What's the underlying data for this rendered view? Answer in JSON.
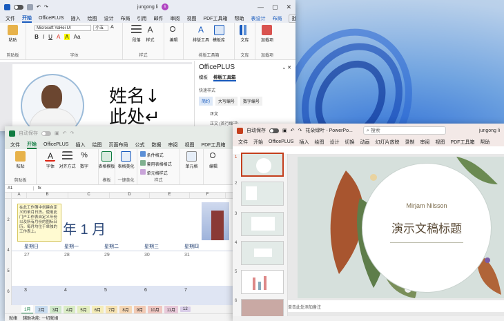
{
  "word": {
    "title": "",
    "user": "jungong li",
    "avatar_initial": "li",
    "tabs": [
      "文件",
      "开始",
      "OfficePLUS",
      "插入",
      "绘图",
      "设计",
      "布局",
      "引用",
      "邮件",
      "审阅",
      "视图",
      "PDF工具箱",
      "帮助",
      "表设计",
      "布局"
    ],
    "comment_label": "批注",
    "font_name": "Microsoft YaHei UI",
    "font_size": "小五",
    "groups": {
      "clipboard": "剪贴板",
      "font": "字体",
      "styles": "样式",
      "typeset": "排版工具箱",
      "docs": "文库",
      "addins": "加载项"
    },
    "buttons": {
      "paste": "粘贴",
      "paragraph": "段落",
      "style": "样式",
      "edit": "编辑",
      "typeset_tool": "排版工具",
      "template_lib": "模板库",
      "library": "文库",
      "addins": "加载项"
    },
    "doc_text_1": "姓名↓",
    "doc_text_2": "此处↵",
    "pane": {
      "title": "OfficePLUS",
      "tabs": [
        "模板",
        "排版工具箱"
      ],
      "section": "快速样式",
      "chips": [
        "简约",
        "大写编号",
        "数字编号"
      ],
      "item1": "正文",
      "item2": "正文 (首行缩进)"
    }
  },
  "excel": {
    "title_left": "自动保存",
    "title_mid": "",
    "tabs": [
      "文件",
      "开始",
      "OfficePLUS",
      "插入",
      "绘图",
      "页面布局",
      "公式",
      "数据",
      "审阅",
      "视图",
      "PDF工具箱",
      "帮助"
    ],
    "groups": {
      "clipboard": "剪贴板",
      "template": "模板",
      "beautify": "一键美化",
      "styles": "样式"
    },
    "buttons": {
      "paste": "粘贴",
      "font": "字体",
      "align": "对齐方式",
      "number": "数字",
      "table_template": "表格模板",
      "table_beautify": "表格美化",
      "cond_format": "条件格式",
      "table_format": "套用表格格式",
      "cell_style": "单元格样式",
      "cells": "单元格",
      "edit": "编辑",
      "analyze": "分析"
    },
    "name_box": "A1",
    "fx": "fx",
    "columns": [
      "A",
      "B",
      "C",
      "D",
      "E",
      "F"
    ],
    "tooltip": "在此工作簿中创建自定义的单月日历。使用此门户工作表自定义年份以及所有月份的图标日历。每月均位于单独的工作表上。",
    "month_title": "年 1 月",
    "weekdays": [
      "星期日",
      "星期一",
      "星期二",
      "星期三",
      "星期四"
    ],
    "row1_dates": [
      "27",
      "28",
      "29",
      "30",
      "31"
    ],
    "row2_dates": [
      "3",
      "4",
      "5",
      "6",
      "7"
    ],
    "sheet_tabs": [
      "1月",
      "2月",
      "3月",
      "4月",
      "5月",
      "6月",
      "7月",
      "8月",
      "9月",
      "10月",
      "11月",
      "12"
    ],
    "status_left": "就绪",
    "status_access": "辅助功能: 一切就绪"
  },
  "ppt": {
    "autosave": "自动保存",
    "title": "花朵绿叶 - PowerPo...",
    "search": "搜索",
    "user": "jungong li",
    "tabs": [
      "文件",
      "开始",
      "OfficePLUS",
      "插入",
      "绘图",
      "设计",
      "切换",
      "动画",
      "幻灯片放映",
      "录制",
      "审阅",
      "视图",
      "PDF工具箱",
      "帮助"
    ],
    "thumb_numbers": [
      "1",
      "2",
      "3",
      "4",
      "5",
      "6"
    ],
    "slide_name": "Mirjam Nilsson",
    "slide_title": "演示文稿标题",
    "notes_placeholder": "单击此处添加备注",
    "status_text": "幻灯片 第 1 张，共 12 张"
  },
  "colors": {
    "word_blue": "#185abd",
    "excel_green": "#107c41",
    "ppt_red": "#c43e1c",
    "avatar": "#b146c2"
  }
}
